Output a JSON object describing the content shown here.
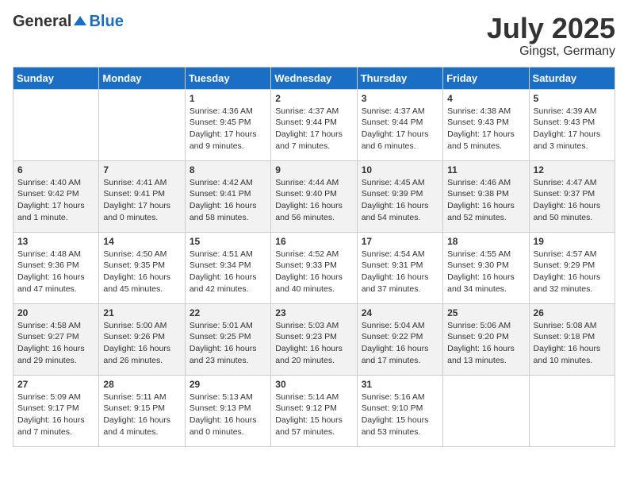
{
  "header": {
    "logo_general": "General",
    "logo_blue": "Blue",
    "month": "July 2025",
    "location": "Gingst, Germany"
  },
  "days_of_week": [
    "Sunday",
    "Monday",
    "Tuesday",
    "Wednesday",
    "Thursday",
    "Friday",
    "Saturday"
  ],
  "weeks": [
    [
      {
        "day": "",
        "info": ""
      },
      {
        "day": "",
        "info": ""
      },
      {
        "day": "1",
        "info": "Sunrise: 4:36 AM\nSunset: 9:45 PM\nDaylight: 17 hours and 9 minutes."
      },
      {
        "day": "2",
        "info": "Sunrise: 4:37 AM\nSunset: 9:44 PM\nDaylight: 17 hours and 7 minutes."
      },
      {
        "day": "3",
        "info": "Sunrise: 4:37 AM\nSunset: 9:44 PM\nDaylight: 17 hours and 6 minutes."
      },
      {
        "day": "4",
        "info": "Sunrise: 4:38 AM\nSunset: 9:43 PM\nDaylight: 17 hours and 5 minutes."
      },
      {
        "day": "5",
        "info": "Sunrise: 4:39 AM\nSunset: 9:43 PM\nDaylight: 17 hours and 3 minutes."
      }
    ],
    [
      {
        "day": "6",
        "info": "Sunrise: 4:40 AM\nSunset: 9:42 PM\nDaylight: 17 hours and 1 minute."
      },
      {
        "day": "7",
        "info": "Sunrise: 4:41 AM\nSunset: 9:41 PM\nDaylight: 17 hours and 0 minutes."
      },
      {
        "day": "8",
        "info": "Sunrise: 4:42 AM\nSunset: 9:41 PM\nDaylight: 16 hours and 58 minutes."
      },
      {
        "day": "9",
        "info": "Sunrise: 4:44 AM\nSunset: 9:40 PM\nDaylight: 16 hours and 56 minutes."
      },
      {
        "day": "10",
        "info": "Sunrise: 4:45 AM\nSunset: 9:39 PM\nDaylight: 16 hours and 54 minutes."
      },
      {
        "day": "11",
        "info": "Sunrise: 4:46 AM\nSunset: 9:38 PM\nDaylight: 16 hours and 52 minutes."
      },
      {
        "day": "12",
        "info": "Sunrise: 4:47 AM\nSunset: 9:37 PM\nDaylight: 16 hours and 50 minutes."
      }
    ],
    [
      {
        "day": "13",
        "info": "Sunrise: 4:48 AM\nSunset: 9:36 PM\nDaylight: 16 hours and 47 minutes."
      },
      {
        "day": "14",
        "info": "Sunrise: 4:50 AM\nSunset: 9:35 PM\nDaylight: 16 hours and 45 minutes."
      },
      {
        "day": "15",
        "info": "Sunrise: 4:51 AM\nSunset: 9:34 PM\nDaylight: 16 hours and 42 minutes."
      },
      {
        "day": "16",
        "info": "Sunrise: 4:52 AM\nSunset: 9:33 PM\nDaylight: 16 hours and 40 minutes."
      },
      {
        "day": "17",
        "info": "Sunrise: 4:54 AM\nSunset: 9:31 PM\nDaylight: 16 hours and 37 minutes."
      },
      {
        "day": "18",
        "info": "Sunrise: 4:55 AM\nSunset: 9:30 PM\nDaylight: 16 hours and 34 minutes."
      },
      {
        "day": "19",
        "info": "Sunrise: 4:57 AM\nSunset: 9:29 PM\nDaylight: 16 hours and 32 minutes."
      }
    ],
    [
      {
        "day": "20",
        "info": "Sunrise: 4:58 AM\nSunset: 9:27 PM\nDaylight: 16 hours and 29 minutes."
      },
      {
        "day": "21",
        "info": "Sunrise: 5:00 AM\nSunset: 9:26 PM\nDaylight: 16 hours and 26 minutes."
      },
      {
        "day": "22",
        "info": "Sunrise: 5:01 AM\nSunset: 9:25 PM\nDaylight: 16 hours and 23 minutes."
      },
      {
        "day": "23",
        "info": "Sunrise: 5:03 AM\nSunset: 9:23 PM\nDaylight: 16 hours and 20 minutes."
      },
      {
        "day": "24",
        "info": "Sunrise: 5:04 AM\nSunset: 9:22 PM\nDaylight: 16 hours and 17 minutes."
      },
      {
        "day": "25",
        "info": "Sunrise: 5:06 AM\nSunset: 9:20 PM\nDaylight: 16 hours and 13 minutes."
      },
      {
        "day": "26",
        "info": "Sunrise: 5:08 AM\nSunset: 9:18 PM\nDaylight: 16 hours and 10 minutes."
      }
    ],
    [
      {
        "day": "27",
        "info": "Sunrise: 5:09 AM\nSunset: 9:17 PM\nDaylight: 16 hours and 7 minutes."
      },
      {
        "day": "28",
        "info": "Sunrise: 5:11 AM\nSunset: 9:15 PM\nDaylight: 16 hours and 4 minutes."
      },
      {
        "day": "29",
        "info": "Sunrise: 5:13 AM\nSunset: 9:13 PM\nDaylight: 16 hours and 0 minutes."
      },
      {
        "day": "30",
        "info": "Sunrise: 5:14 AM\nSunset: 9:12 PM\nDaylight: 15 hours and 57 minutes."
      },
      {
        "day": "31",
        "info": "Sunrise: 5:16 AM\nSunset: 9:10 PM\nDaylight: 15 hours and 53 minutes."
      },
      {
        "day": "",
        "info": ""
      },
      {
        "day": "",
        "info": ""
      }
    ]
  ]
}
